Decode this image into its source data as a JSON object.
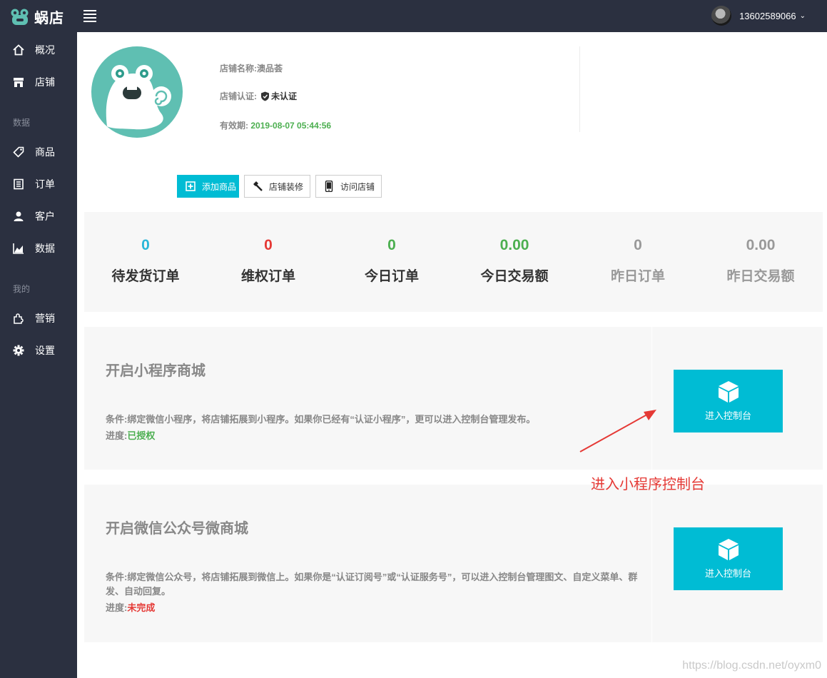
{
  "app": {
    "logo_text": "蜗店",
    "user_name": "13602589066"
  },
  "sidebar": {
    "items": [
      {
        "label": "概况",
        "icon": "home-icon"
      },
      {
        "label": "店铺",
        "icon": "store-icon"
      },
      {
        "label": "商品",
        "icon": "tag-icon"
      },
      {
        "label": "订单",
        "icon": "order-icon"
      },
      {
        "label": "客户",
        "icon": "user-icon"
      },
      {
        "label": "数据",
        "icon": "chart-icon"
      },
      {
        "label": "营销",
        "icon": "puzzle-icon"
      },
      {
        "label": "设置",
        "icon": "gear-icon"
      }
    ],
    "groups": [
      "数据",
      "我的"
    ]
  },
  "shop": {
    "name_label": "店铺名称:",
    "name": "澳品荟",
    "cert_label": "店铺认证:",
    "cert_status": "未认证",
    "expire_label": "有效期:",
    "expire_value": "2019-08-07 05:44:56"
  },
  "actions": {
    "add_product": "添加商品",
    "decorate": "店铺装修",
    "visit": "访问店铺"
  },
  "stats": [
    {
      "value": "0",
      "label": "待发货订单",
      "color": "#29b6d8",
      "label_color": "#333333"
    },
    {
      "value": "0",
      "label": "维权订单",
      "color": "#e53935",
      "label_color": "#333333"
    },
    {
      "value": "0",
      "label": "今日订单",
      "color": "#4caf50",
      "label_color": "#333333"
    },
    {
      "value": "0.00",
      "label": "今日交易额",
      "color": "#4caf50",
      "label_color": "#333333"
    },
    {
      "value": "0",
      "label": "昨日订单",
      "color": "#999999",
      "label_color": "#999999"
    },
    {
      "value": "0.00",
      "label": "昨日交易额",
      "color": "#999999",
      "label_color": "#999999"
    }
  ],
  "panels": {
    "miniapp": {
      "title": "开启小程序商城",
      "condition": "条件:绑定微信小程序，将店铺拓展到小程序。如果你已经有“认证小程序”，更可以进入控制台管理发布。",
      "progress_label": "进度:",
      "progress_value": "已授权",
      "button": "进入控制台"
    },
    "wechat": {
      "title": "开启微信公众号微商城",
      "condition": "条件:绑定微信公众号，将店铺拓展到微信上。如果你是“认证订阅号”或“认证服务号”，可以进入控制台管理图文、自定义菜单、群发、自动回复。",
      "progress_label": "进度:",
      "progress_value": "未完成",
      "button": "进入控制台"
    }
  },
  "annotation": {
    "text": "进入小程序控制台",
    "color": "#e53935"
  },
  "watermark": "https://blog.csdn.net/oyxm0",
  "colors": {
    "sidebar_bg": "#2b3040",
    "accent": "#00bcd4",
    "panel_bg": "#f7f7f7"
  }
}
